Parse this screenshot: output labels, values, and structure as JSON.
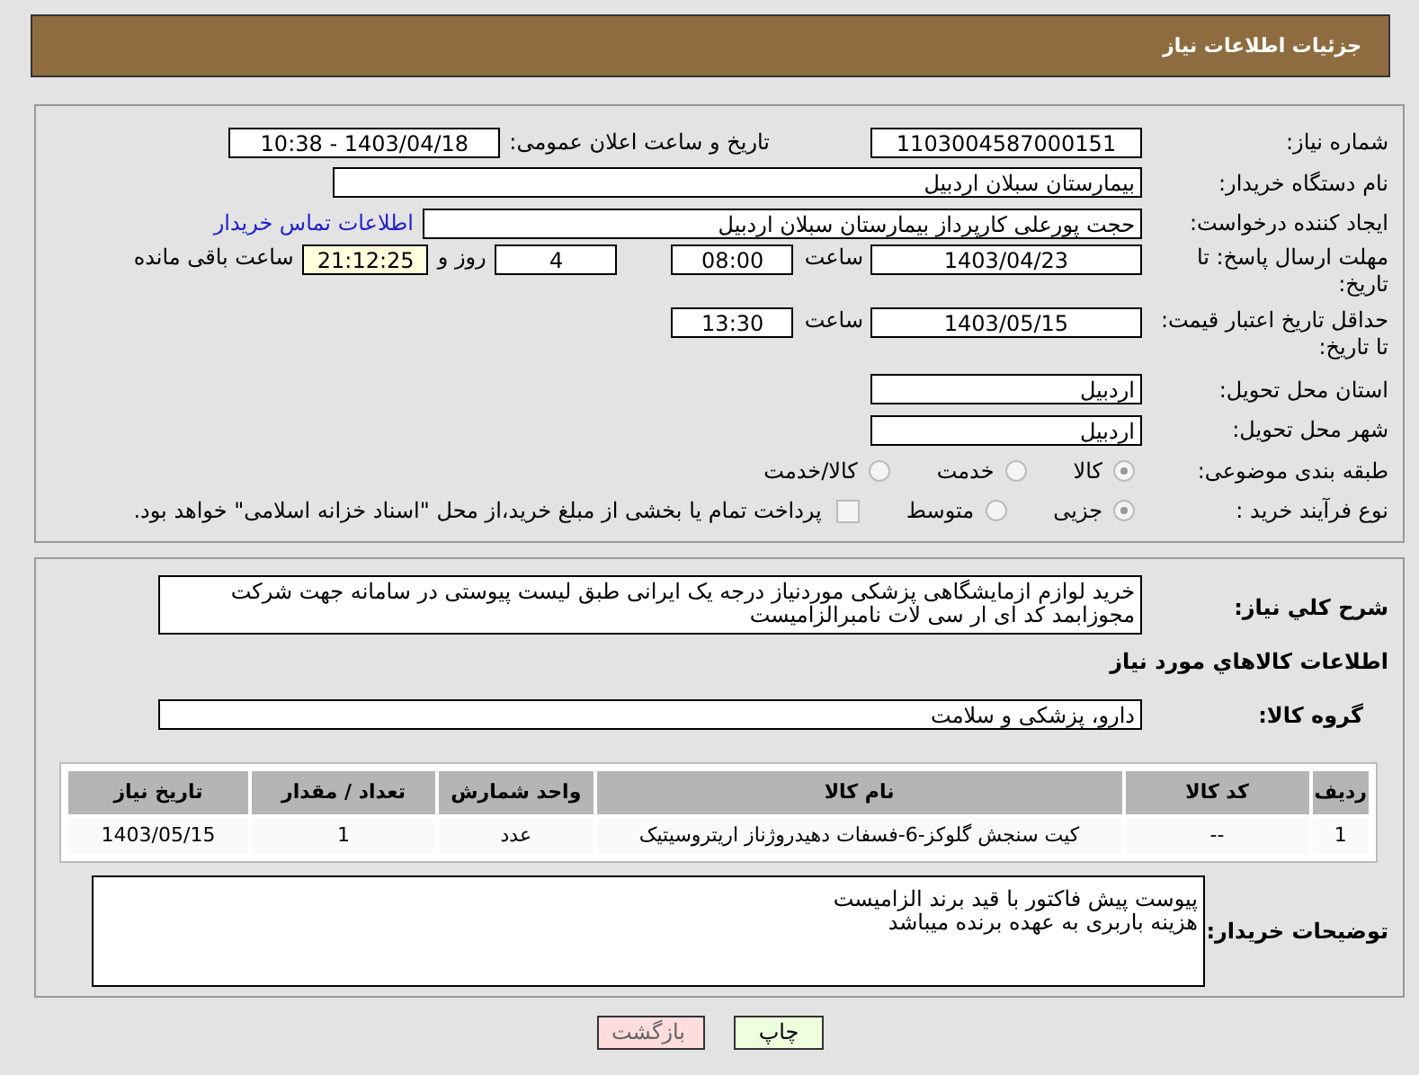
{
  "header": {
    "title": "جزئیات اطلاعات نیاز"
  },
  "need_number": {
    "label": "شماره نیاز:",
    "value": "1103004587000151"
  },
  "announce": {
    "label": "تاریخ و ساعت اعلان عمومی:",
    "value": "1403/04/18 - 10:38"
  },
  "buyer_org": {
    "label": "نام دستگاه خریدار:",
    "value": "بیمارستان سبلان اردبیل"
  },
  "creator": {
    "label": "ایجاد کننده درخواست:",
    "value": "حجت پورعلی کارپرداز بیمارستان سبلان اردبیل",
    "link": "اطلاعات تماس خریدار"
  },
  "reply_deadline": {
    "label": "مهلت ارسال پاسخ: تا تاریخ:",
    "date": "1403/04/23",
    "time_label": "ساعت",
    "time": "08:00",
    "days": "4",
    "days_label": "روز و",
    "remaining": "21:12:25",
    "remaining_label": "ساعت باقی مانده"
  },
  "price_validity": {
    "label": "حداقل تاریخ اعتبار قیمت: تا تاریخ:",
    "date": "1403/05/15",
    "time_label": "ساعت",
    "time": "13:30"
  },
  "province": {
    "label": "استان محل تحویل:",
    "value": "اردبیل"
  },
  "city": {
    "label": "شهر محل تحویل:",
    "value": "اردبیل"
  },
  "category": {
    "label": "طبقه بندی موضوعی:",
    "options": [
      {
        "label": "کالا",
        "selected": true
      },
      {
        "label": "خدمت",
        "selected": false
      },
      {
        "label": "کالا/خدمت",
        "selected": false
      }
    ]
  },
  "process": {
    "label": "نوع فرآیند خرید :",
    "options": [
      {
        "label": "جزیی",
        "selected": true
      },
      {
        "label": "متوسط",
        "selected": false
      }
    ],
    "treasury": {
      "label": "پرداخت تمام یا بخشی از مبلغ خرید،از محل \"اسناد خزانه اسلامی\" خواهد بود.",
      "checked": false
    }
  },
  "description": {
    "label": "شرح کلي نياز:",
    "lines": [
      "خرید لوازم ازمایشگاهی پزشکی موردنیاز درجه یک ایرانی طبق لیست پیوستی در سامانه جهت شرکت",
      "مجوزابمد کد ای ار سی لات نامبرالزامیست"
    ]
  },
  "goods_title": "اطلاعات کالاهاي مورد نياز",
  "goods_group": {
    "label": "گروه کالا:",
    "value": "دارو، پزشکی و سلامت"
  },
  "table": {
    "columns": [
      "ردیف",
      "کد کالا",
      "نام کالا",
      "واحد شمارش",
      "تعداد / مقدار",
      "تاریخ نیاز"
    ],
    "rows": [
      [
        "1",
        "--",
        "کیت سنجش گلوکز-6-فسفات دهیدروژناز اریتروسیتیک",
        "عدد",
        "1",
        "1403/05/15"
      ]
    ]
  },
  "buyer_notes": {
    "label": "توضیحات خریدار:",
    "lines": [
      "پیوست پیش فاکتور با قید برند الزامیست",
      "هزینه باربری به عهده برنده میباشد"
    ]
  },
  "buttons": [
    {
      "label": "چاپ",
      "kind": "print"
    },
    {
      "label": "بازگشت",
      "kind": "back"
    }
  ]
}
